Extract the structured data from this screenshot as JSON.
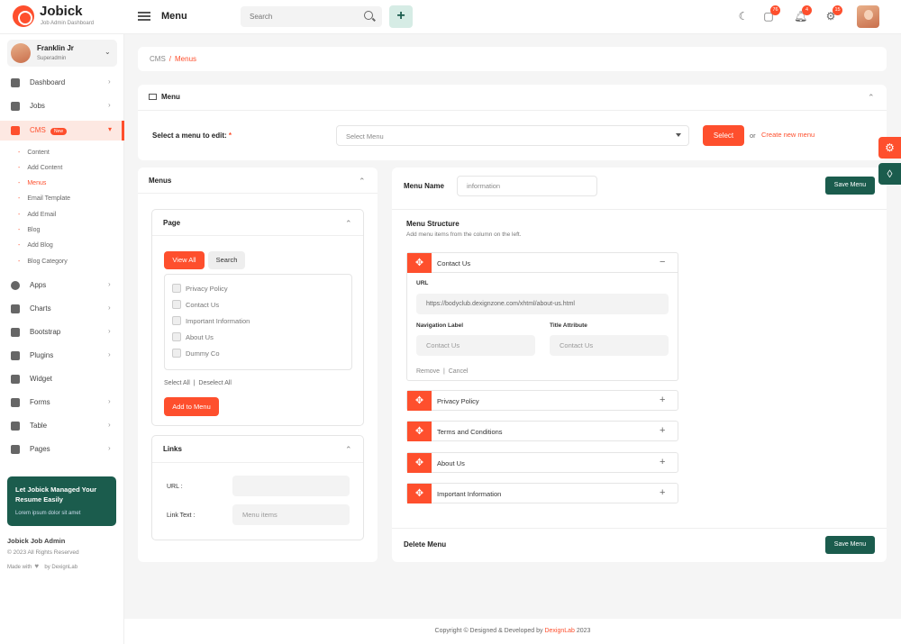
{
  "brand": {
    "name": "Jobick",
    "subtitle": "Job Admin Dashboard"
  },
  "header": {
    "title": "Menu",
    "search_placeholder": "Search",
    "add_label": "+",
    "messages_count": "76",
    "notifications_count": "4",
    "settings_count": "15"
  },
  "user": {
    "name": "Franklin Jr",
    "role": "Superadmin"
  },
  "sidebar": {
    "items": [
      {
        "label": "Dashboard"
      },
      {
        "label": "Jobs"
      },
      {
        "label": "CMS",
        "badge": "New"
      },
      {
        "label": "Apps"
      },
      {
        "label": "Charts"
      },
      {
        "label": "Bootstrap"
      },
      {
        "label": "Plugins"
      },
      {
        "label": "Widget"
      },
      {
        "label": "Forms"
      },
      {
        "label": "Table"
      },
      {
        "label": "Pages"
      }
    ],
    "cms_sub": [
      "Content",
      "Add Content",
      "Menus",
      "Email Template",
      "Add Email",
      "Blog",
      "Add Blog",
      "Blog Category"
    ],
    "promo_title": "Let Jobick Managed Your Resume Easily",
    "promo_text": "Lorem ipsum dolor sit amet",
    "footer_name": "Jobick Job Admin",
    "footer_copy": "© 2023 All Rights Reserved",
    "footer_made_pre": "Made with",
    "footer_made_post": "by DexignLab"
  },
  "breadcrumb": {
    "parent": "CMS",
    "separator": "/",
    "current": "Menus"
  },
  "menu_select": {
    "title": "Menu",
    "label": "Select a menu to edit:",
    "required": "*",
    "placeholder": "Select Menu",
    "select_button": "Select",
    "or": "or",
    "create_link": "Create new menu"
  },
  "menus_panel": {
    "title": "Menus",
    "page_title": "Page",
    "view_all": "View All",
    "search": "Search",
    "pages": [
      "Privacy Policy",
      "Contact Us",
      "Important Information",
      "About Us",
      "Dummy Co"
    ],
    "select_all": "Select All",
    "deselect_all": "Deselect All",
    "add_button": "Add to Menu",
    "links_title": "Links",
    "url_label": "URL :",
    "link_text_label": "Link Text :",
    "link_text_placeholder": "Menu items"
  },
  "structure": {
    "menu_name_label": "Menu Name",
    "menu_name_value": "information",
    "save_button": "Save Menu",
    "title": "Menu Structure",
    "subtitle": "Add menu items from the column on the left.",
    "expanded": {
      "name": "Contact Us",
      "toggle": "−",
      "url_label": "URL",
      "url_value": "https://bodyclub.dexignzone.com/xhtml/about-us.html",
      "nav_label": "Navigation Label",
      "nav_value": "Contact Us",
      "title_attr_label": "Title Attribute",
      "title_attr_value": "Contact Us",
      "remove": "Remove",
      "cancel": "Cancel"
    },
    "items": [
      {
        "name": "Privacy Policy",
        "toggle": "+"
      },
      {
        "name": "Terms and Conditions",
        "toggle": "+"
      },
      {
        "name": "About Us",
        "toggle": "+"
      },
      {
        "name": "Important Information",
        "toggle": "+"
      }
    ],
    "delete_menu": "Delete Menu"
  },
  "footer": {
    "text": "Copyright © Designed & Developed by",
    "brand": "DexignLab",
    "year": "2023"
  },
  "colors": {
    "accent": "#fe4f2d",
    "dark_green": "#1b5c4d"
  }
}
